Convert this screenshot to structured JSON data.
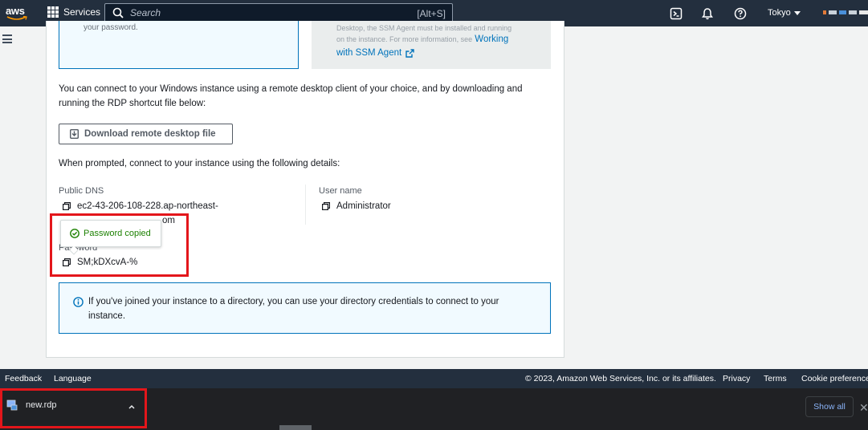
{
  "topnav": {
    "logo_text": "aws",
    "services_label": "Services",
    "search_placeholder": "Search",
    "search_shortcut": "[Alt+S]",
    "region": "Tokyo",
    "icons": [
      "cloudshell-icon",
      "bell-icon",
      "help-icon"
    ],
    "account_colors": [
      "#e07b39",
      "#c9d1d9",
      "#4a90d9",
      "#c9d1d9",
      "#e8e8e8"
    ]
  },
  "top_boxes": {
    "left_text": "your password.",
    "right_faint_line1": "Desktop, the SSM Agent must be installed and running",
    "right_faint_prefix": "on the instance. For more information, see",
    "right_link_line1": "Working",
    "right_link_line2": "with SSM Agent"
  },
  "main": {
    "intro": "You can connect to your Windows instance using a remote desktop client of your choice, and by downloading and running the RDP shortcut file below:",
    "download_button": "Download remote desktop file",
    "prompt": "When prompted, connect to your instance using the following details:",
    "public_dns_label": "Public DNS",
    "public_dns_value": "ec2-43-206-108-228.ap-northeast-",
    "public_dns_value_line2": "om",
    "username_label": "User name",
    "username_value": "Administrator",
    "password_label": "Password",
    "password_value": "SM;kDXcvA-%",
    "tooltip": "Password copied",
    "info": "If you've joined your instance to a directory, you can use your directory credentials to connect to your instance."
  },
  "footer": {
    "feedback": "Feedback",
    "language": "Language",
    "copyright": "© 2023, Amazon Web Services, Inc. or its affiliates.",
    "privacy": "Privacy",
    "terms": "Terms",
    "cookies": "Cookie preferences"
  },
  "shelf": {
    "filename": "new.rdp",
    "show_all": "Show all"
  },
  "colors": {
    "nav": "#232f3e",
    "link": "#0073bb",
    "success": "#1d8102",
    "highlight": "#e3161b"
  }
}
